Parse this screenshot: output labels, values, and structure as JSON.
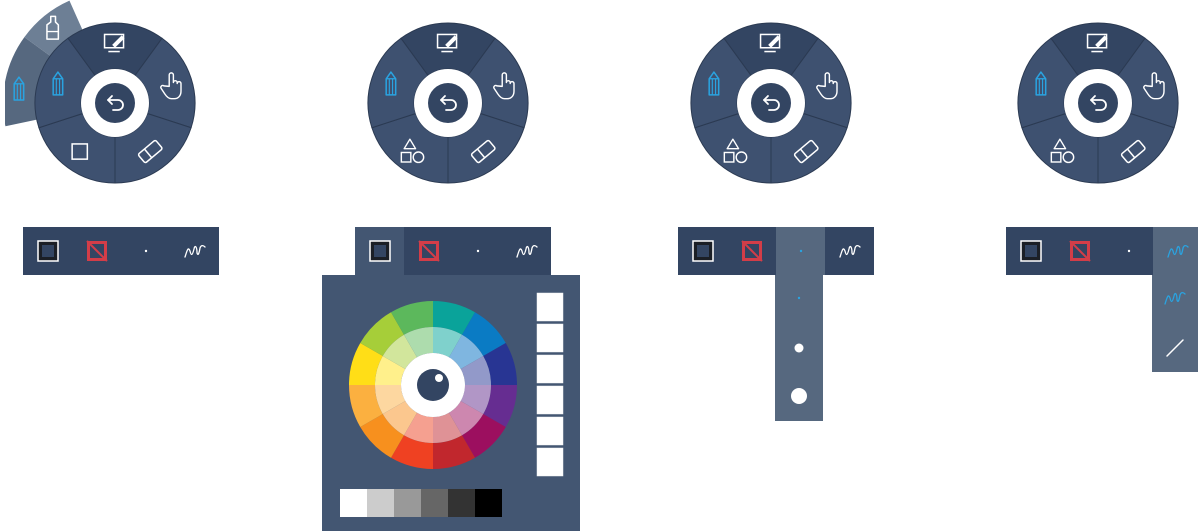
{
  "colors": {
    "panel": "#3e5170",
    "panel_dark": "#334562",
    "panel_light": "#56687f",
    "panel_popup": "#435672",
    "accent": "#2aa3e0",
    "icon": "#ffffff",
    "stroke_swatch": "#d33d48"
  },
  "radial_menus": [
    {
      "name": "radial-menu-1",
      "expanded_segment": "pen",
      "segments": [
        {
          "icon": "screen-annotate-icon",
          "active": false
        },
        {
          "icon": "hand-pointer-icon",
          "active": false
        },
        {
          "icon": "eraser-icon",
          "active": false
        },
        {
          "icon": "rectangle-shape-icon",
          "active": false
        },
        {
          "icon": "pencil-icon",
          "active": true
        }
      ],
      "flyout": [
        {
          "icon": "highlighter-icon",
          "active": false
        },
        {
          "icon": "pencil-icon",
          "active": true
        }
      ],
      "center_icon": "undo-arrow-icon"
    },
    {
      "name": "radial-menu-2",
      "segments": [
        {
          "icon": "screen-annotate-icon",
          "active": false
        },
        {
          "icon": "hand-pointer-icon",
          "active": false
        },
        {
          "icon": "eraser-icon",
          "active": false
        },
        {
          "icon": "shapes-icon",
          "active": false
        },
        {
          "icon": "pencil-icon",
          "active": true
        }
      ],
      "center_icon": "undo-arrow-icon"
    },
    {
      "name": "radial-menu-3",
      "segments": [
        {
          "icon": "screen-annotate-icon",
          "active": false
        },
        {
          "icon": "hand-pointer-icon",
          "active": false
        },
        {
          "icon": "eraser-icon",
          "active": false
        },
        {
          "icon": "shapes-icon",
          "active": false
        },
        {
          "icon": "pencil-icon",
          "active": true
        }
      ],
      "center_icon": "undo-arrow-icon"
    },
    {
      "name": "radial-menu-4",
      "segments": [
        {
          "icon": "screen-annotate-icon",
          "active": false
        },
        {
          "icon": "hand-pointer-icon",
          "active": false
        },
        {
          "icon": "eraser-icon",
          "active": false
        },
        {
          "icon": "shapes-icon",
          "active": false
        },
        {
          "icon": "pencil-icon",
          "active": true
        }
      ],
      "center_icon": "undo-arrow-icon"
    }
  ],
  "toolbars": [
    {
      "name": "pen-toolbar-1",
      "tools": [
        "fill-color-icon",
        "stroke-color-icon",
        "stroke-size-icon",
        "stroke-style-icon"
      ],
      "active_tool": null
    },
    {
      "name": "pen-toolbar-2",
      "tools": [
        "fill-color-icon",
        "stroke-color-icon",
        "stroke-size-icon",
        "stroke-style-icon"
      ],
      "active_tool": "fill-color-icon"
    },
    {
      "name": "pen-toolbar-3",
      "tools": [
        "fill-color-icon",
        "stroke-color-icon",
        "stroke-size-icon",
        "stroke-style-icon"
      ],
      "active_tool": "stroke-size-icon"
    },
    {
      "name": "pen-toolbar-4",
      "tools": [
        "fill-color-icon",
        "stroke-color-icon",
        "stroke-size-icon",
        "stroke-style-icon"
      ],
      "active_tool": "stroke-style-icon"
    }
  ],
  "color_picker": {
    "wheel_outer": [
      "#0aa39a",
      "#0a7bc4",
      "#283593",
      "#662d91",
      "#9c0f5f",
      "#c1272d",
      "#ef4122",
      "#f7901e",
      "#fbb040",
      "#ffde17",
      "#a6ce39",
      "#5cb85c"
    ],
    "wheel_inner": [
      "#7fd1cc",
      "#7fb6e0",
      "#9299c9",
      "#b196c6",
      "#cd87af",
      "#df9296",
      "#f5a090",
      "#fbc78e",
      "#fdd7a0",
      "#fff08b",
      "#d2e69c",
      "#addcad"
    ],
    "custom_swatches": [
      "#ffffff",
      "#ffffff",
      "#ffffff",
      "#ffffff",
      "#ffffff",
      "#ffffff"
    ],
    "grayscale": [
      "#ffffff",
      "#cccccc",
      "#999999",
      "#666666",
      "#333333",
      "#000000"
    ]
  },
  "stroke_sizes": [
    "small",
    "medium",
    "large"
  ],
  "stroke_sizes_selected": "small",
  "stroke_styles": [
    "freehand-line-icon",
    "straight-line-icon"
  ],
  "stroke_styles_selected": "freehand-line-icon"
}
